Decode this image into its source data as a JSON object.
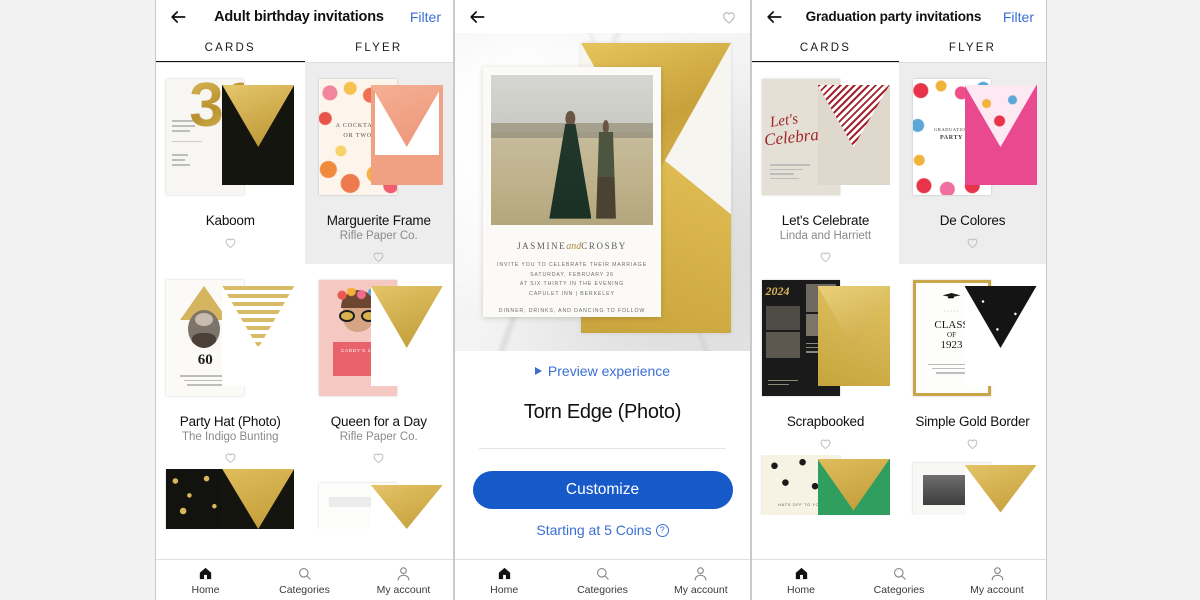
{
  "panels": {
    "left": {
      "title": "Adult birthday invitations",
      "filter_label": "Filter",
      "tabs": [
        {
          "label": "CARDS",
          "active": true
        },
        {
          "label": "FLYER",
          "active": false
        }
      ],
      "cards": [
        {
          "title": "Kaboom",
          "designer": ""
        },
        {
          "title": "Marguerite Frame",
          "designer": "Rifle Paper Co."
        },
        {
          "title": "Party Hat (Photo)",
          "designer": "The Indigo Bunting"
        },
        {
          "title": "Queen for a Day",
          "designer": "Rifle Paper Co."
        }
      ],
      "card_art": {
        "kaboom_numeral": "30",
        "marguerite_headline": "A COCKTAIL",
        "marguerite_headline2": "OR TWO",
        "party_hat_numeral": "60",
        "queen_caption": "CADDY'S 26"
      }
    },
    "middle": {
      "product_title": "Torn Edge (Photo)",
      "preview_label": "Preview experience",
      "customize_label": "Customize",
      "price_label": "Starting at 5 Coins",
      "invitation": {
        "name_first": "JASMINE",
        "name_script": "and",
        "name_second": "CROSBY",
        "lines": [
          "INVITE YOU TO CELEBRATE THEIR MARRIAGE",
          "SATURDAY, FEBRUARY 26",
          "AT SIX THIRTY IN THE EVENING",
          "CAPULET INN | BERKELEY"
        ],
        "footer": "DINNER, DRINKS, AND DANCING TO FOLLOW"
      }
    },
    "right": {
      "title": "Graduation party invitations",
      "filter_label": "Filter",
      "tabs": [
        {
          "label": "CARDS",
          "active": true
        },
        {
          "label": "FLYER",
          "active": false
        }
      ],
      "cards": [
        {
          "title": "Let's Celebrate",
          "designer": "Linda and Harriett"
        },
        {
          "title": "De Colores",
          "designer": ""
        },
        {
          "title": "Scrapbooked",
          "designer": ""
        },
        {
          "title": "Simple Gold Border",
          "designer": ""
        }
      ],
      "card_art": {
        "celebrate_script1": "Let's",
        "celebrate_script2": "Celebrate",
        "decolores_headline": "GRADUATION",
        "decolores_headline2": "PARTY",
        "scrapbooked_year": "2024",
        "gold_border_line1": "CLASS",
        "gold_border_line2": "OF",
        "gold_border_line3": "1923",
        "caps_caption": "HATS OFF TO YOU"
      }
    }
  },
  "bottom_nav": [
    {
      "label": "Home",
      "icon": "home-icon",
      "active": true
    },
    {
      "label": "Categories",
      "icon": "search-icon",
      "active": false
    },
    {
      "label": "My account",
      "icon": "person-icon",
      "active": false
    }
  ],
  "colors": {
    "accent_blue": "#3b6fd4",
    "cta_blue": "#1659c8",
    "page_bg": "#f2f2f2"
  }
}
